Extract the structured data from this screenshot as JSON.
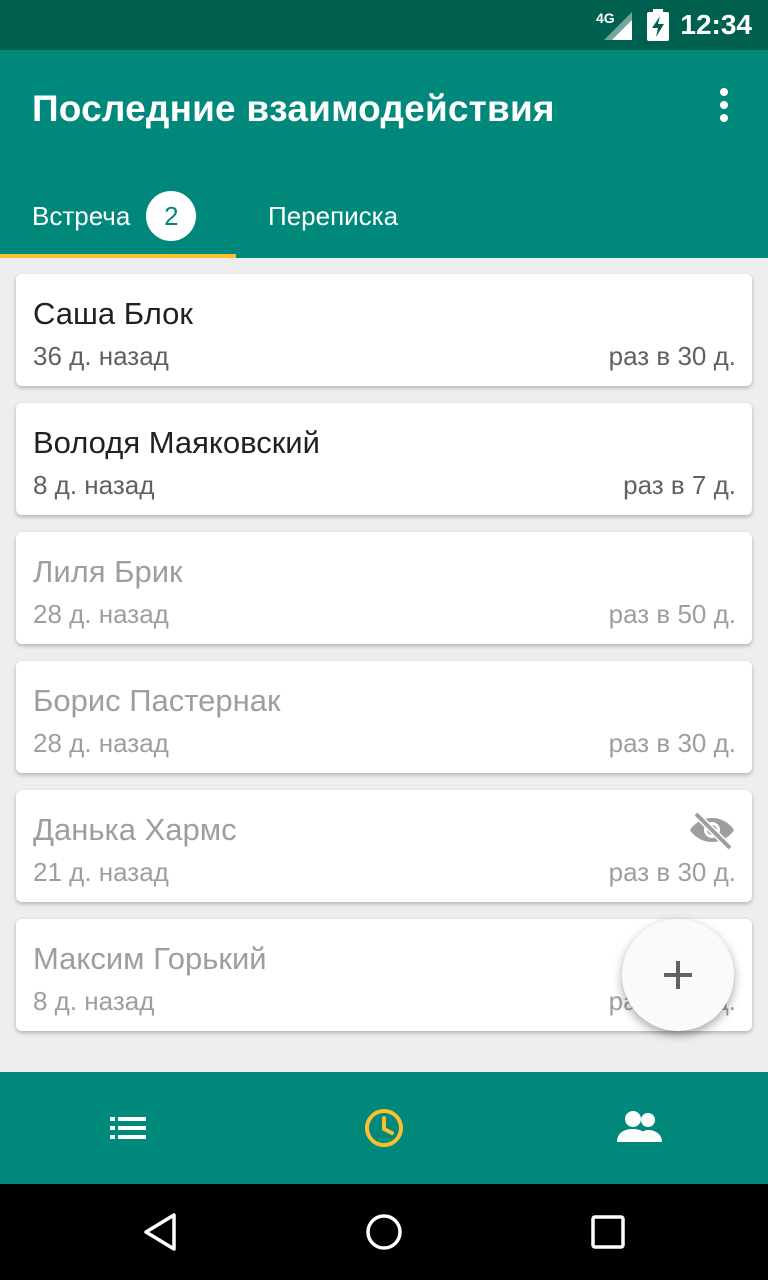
{
  "status_bar": {
    "network": "4G",
    "time": "12:34"
  },
  "app_bar": {
    "title": "Последние взаимодействия"
  },
  "tabs": [
    {
      "label": "Встреча",
      "badge": "2",
      "active": true
    },
    {
      "label": "Переписка",
      "active": false
    }
  ],
  "contacts": [
    {
      "name": "Саша Блок",
      "last_contact": "36 д. назад",
      "frequency": "раз в 30 д.",
      "faded": false
    },
    {
      "name": "Володя Маяковский",
      "last_contact": "8 д. назад",
      "frequency": "раз в 7 д.",
      "faded": false
    },
    {
      "name": "Лиля Брик",
      "last_contact": "28 д. назад",
      "frequency": "раз в 50 д.",
      "faded": true
    },
    {
      "name": "Борис Пастернак",
      "last_contact": "28 д. назад",
      "frequency": "раз в 30 д.",
      "faded": true
    },
    {
      "name": "Данька Хармс",
      "last_contact": "21 д. назад",
      "frequency": "раз в 30 д.",
      "faded": true,
      "icon": "visibility-off-icon"
    },
    {
      "name": "Максим Горький",
      "last_contact": "8 д. назад",
      "frequency": "раз в 30 д.",
      "faded": true
    }
  ],
  "fab": {
    "icon": "add-icon"
  },
  "bottom_nav": [
    {
      "icon": "list-icon",
      "active": false
    },
    {
      "icon": "clock-icon",
      "active": true
    },
    {
      "icon": "people-icon",
      "active": false
    }
  ],
  "colors": {
    "primary": "#00897b",
    "primary_dark": "#00604f",
    "accent": "#fbc02d",
    "background": "#eeeeee"
  }
}
